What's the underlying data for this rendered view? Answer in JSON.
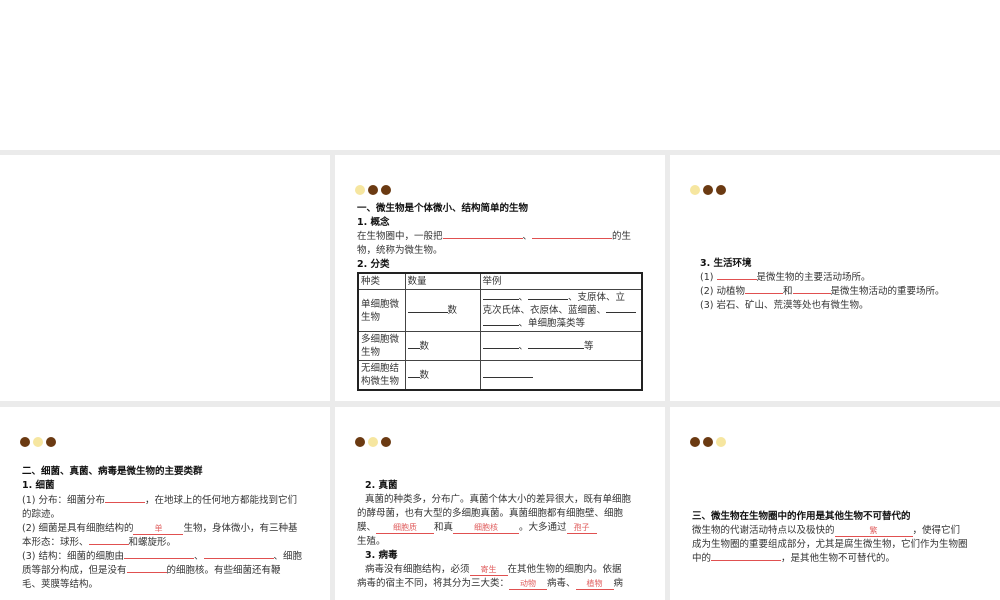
{
  "slide2": {
    "s1": "一、微生物是个体微小、结构简单的生物",
    "s2": "1. 概念",
    "p1a": "在生物圈中，一般把",
    "sep": "、",
    "p1b": "的生",
    "p1c": "物，统称为微生物。",
    "s3": "2. 分类",
    "table": {
      "headers": [
        "种类",
        "数量",
        "举例"
      ],
      "rows": [
        {
          "kind": "单细胞微生物",
          "num": "数",
          "ex1": "、",
          "ex2": "、支原体、立",
          "ex3": "克次氏体、衣原体、蓝细菌、",
          "ex4": "、单细胞藻类等"
        },
        {
          "kind": "多细胞微生物",
          "num": "数",
          "ex1": "、",
          "ex2": "等"
        },
        {
          "kind": "无细胞结构微生物",
          "num": "数"
        }
      ]
    }
  },
  "slide3": {
    "s1": "3. 生活环境",
    "l1a": "(1)",
    "l1b": "是微生物的主要活动场所。",
    "l2a": "(2) 动植物",
    "l2b": "和",
    "l2c": "是微生物活动的重要场所。",
    "l3": "(3) 岩石、矿山、荒漠等处也有微生物。"
  },
  "slide4": {
    "s1": "二、细菌、真菌、病毒是微生物的主要类群",
    "s2": "1. 细菌",
    "l1a": "(1) 分布：细菌分布",
    "l1b": "，在地球上的任何地方都能找到它们",
    "l1c": "的踪迹。",
    "l2a": "(2) 细菌是具有细胞结构的",
    "l2ans": "单",
    "l2b": "生物，身体微小，有三种基",
    "l2c": "本形态：球形、",
    "l2d": "和螺旋形。",
    "l3a": "(3) 结构：细菌的细胞由",
    "l3b": "、",
    "l3c": "、细胞",
    "l3d": "质等部分构成，但是没有",
    "l3e": "的细胞核。有些细菌还有鞭",
    "l3f": "毛、荚膜等结构。"
  },
  "slide5": {
    "s1": "2. 真菌",
    "p1": "真菌的种类多，分布广。真菌个体大小的差异很大，既有单细胞",
    "p2": "的酵母菌，也有大型的多细胞真菌。真菌细胞都有细胞壁、细胞",
    "p3a": "膜、",
    "a1": "细胞质",
    "p3b": "和真",
    "a2": "细胞核",
    "p3c": "。大多通过",
    "a3": "孢子",
    "p4": "生殖。",
    "s2": "3. 病毒",
    "q1a": "病毒没有细胞结构，必须",
    "a4": "寄生",
    "q1b": "在其他生物的细胞内。依据",
    "q2a": "病毒的宿主不同，将其分为三大类：",
    "a5": "动物",
    "q2b": "病毒、",
    "a6": "植物",
    "q2c": "病"
  },
  "slide6": {
    "s1": "三、微生物在生物圈中的作用是其他生物不可替代的",
    "p1a": "微生物的代谢活动特点以及极快的",
    "a1": "繁",
    "p1b": "，使得它们",
    "p2": "成为生物圈的重要组成部分，尤其是腐生微生物，它们作为生物圈",
    "p3a": "中的",
    "p3b": "，是其他生物不可替代的。"
  }
}
